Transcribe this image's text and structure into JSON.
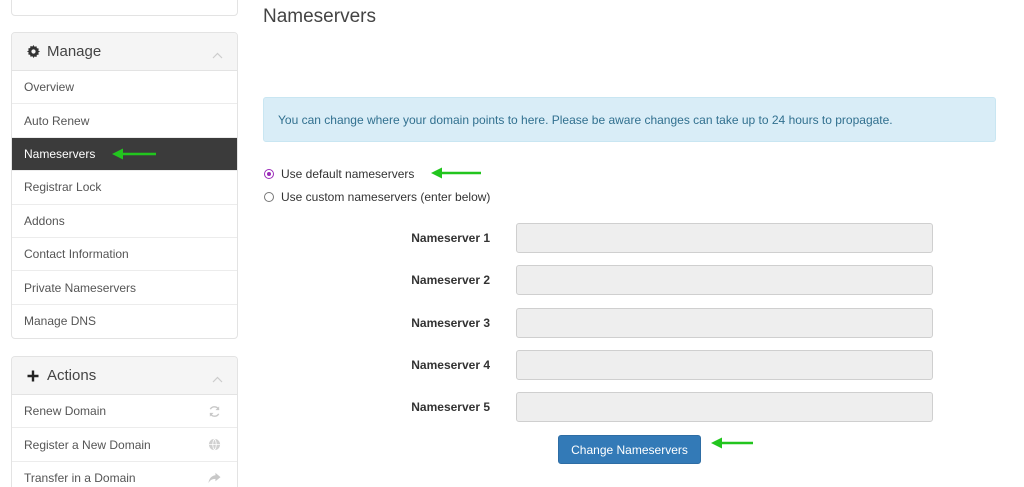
{
  "sidebar": {
    "manage_panel": {
      "title": "Manage",
      "icon": "gear-icon",
      "items": [
        {
          "label": "Overview",
          "active": false
        },
        {
          "label": "Auto Renew",
          "active": false
        },
        {
          "label": "Nameservers",
          "active": true
        },
        {
          "label": "Registrar Lock",
          "active": false
        },
        {
          "label": "Addons",
          "active": false
        },
        {
          "label": "Contact Information",
          "active": false
        },
        {
          "label": "Private Nameservers",
          "active": false
        },
        {
          "label": "Manage DNS",
          "active": false
        }
      ]
    },
    "actions_panel": {
      "title": "Actions",
      "icon": "plus-icon",
      "items": [
        {
          "label": "Renew Domain",
          "icon": "refresh-icon"
        },
        {
          "label": "Register a New Domain",
          "icon": "globe-icon"
        },
        {
          "label": "Transfer in a Domain",
          "icon": "share-arrow-icon"
        }
      ]
    }
  },
  "main": {
    "title": "Nameservers",
    "info_alert": "You can change where your domain points to here. Please be aware changes can take up to 24 hours to propagate.",
    "options": [
      {
        "label": "Use default nameservers",
        "checked": true
      },
      {
        "label": "Use custom nameservers (enter below)",
        "checked": false
      }
    ],
    "nameservers": [
      {
        "label": "Nameserver 1",
        "value": ""
      },
      {
        "label": "Nameserver 2",
        "value": ""
      },
      {
        "label": "Nameserver 3",
        "value": ""
      },
      {
        "label": "Nameserver 4",
        "value": ""
      },
      {
        "label": "Nameserver 5",
        "value": ""
      }
    ],
    "submit_label": "Change Nameservers"
  },
  "colors": {
    "active_item_bg": "#3b3b3b",
    "alert_bg": "#d9edf7",
    "primary_button": "#337ab7",
    "annotation_arrow": "#22c51e",
    "radio_checked": "#9a2bb8"
  }
}
